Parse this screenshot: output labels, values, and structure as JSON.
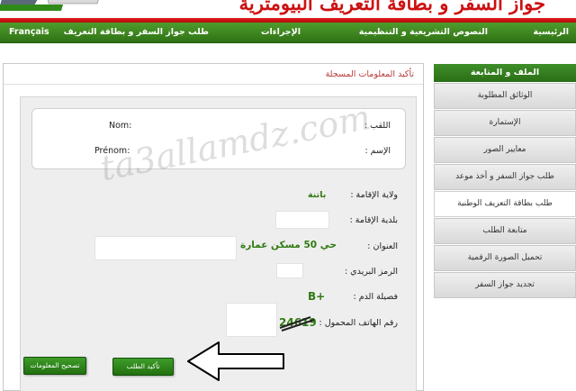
{
  "header": {
    "title": "جواز السفر و بطاقة التعريف البيومترية"
  },
  "nav": {
    "items": [
      {
        "label": "الرئيسية"
      },
      {
        "label": "النصوص التشريعية و التنظيمية"
      },
      {
        "label": "الإجراءات"
      },
      {
        "label": "طلب جواز السفر و بطاقة التعريف"
      },
      {
        "label": "Français"
      }
    ]
  },
  "sidebar": {
    "heading": "الملف و المتابعة",
    "items": [
      {
        "label": "الوثائق المطلوبة"
      },
      {
        "label": "الإستمارة"
      },
      {
        "label": "معايير الصور"
      },
      {
        "label": "طلب جواز السفر و أخذ موعد"
      },
      {
        "label": "طلب بطاقة التعريف الوطنية"
      },
      {
        "label": "متابعة الطلب"
      },
      {
        "label": "تحميل الصورة الرقمية"
      },
      {
        "label": "تجديد جواز السفر"
      }
    ],
    "active_index": 4
  },
  "main": {
    "title": "تأكيد المعلومات المسجلة",
    "name_box": {
      "nom_label": "Nom:",
      "laqab_label": "اللقب :",
      "prenom_label": "Prénom:",
      "ism_label": "الإسم :"
    },
    "fields": {
      "wilaya_label": "ولاية الإقامة :",
      "wilaya_value": "باتنة",
      "baladia_label": "بلدية الإقامة :",
      "address_label": "العنوان :",
      "address_value": "حي 50 مسكن عمارة",
      "postal_label": "الرمز البريدي :",
      "blood_label": "فصيلة الدم :",
      "blood_value": "B+",
      "phone_label": "رقم الهاتف المحمول :",
      "phone_value": "24619"
    },
    "buttons": {
      "confirm": "تأكيد الطلب",
      "correct": "تصحيح المعلومات"
    }
  },
  "watermark": "ta3allamdz.com",
  "colors": {
    "brand_green": "#2f7214",
    "brand_red": "#cc1010",
    "value_green": "#2f7a12",
    "title_red": "#b83a3a"
  }
}
